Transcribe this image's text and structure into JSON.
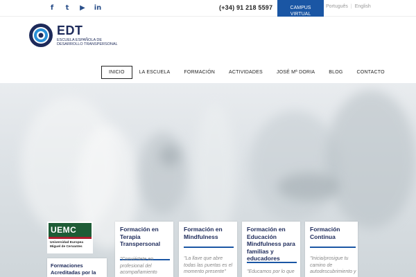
{
  "topbar": {
    "social": [
      {
        "icon": "facebook-icon",
        "glyph": "f"
      },
      {
        "icon": "twitter-icon",
        "glyph": "t"
      },
      {
        "icon": "youtube-icon",
        "glyph": "▶"
      },
      {
        "icon": "linkedin-icon",
        "glyph": "in"
      }
    ],
    "phone": "(+34) 91 218 5597",
    "campus_line1": "CAMPUS",
    "campus_line2": "VIRTUAL",
    "lang_pt": "Português",
    "lang_sep": "|",
    "lang_en": "English"
  },
  "header": {
    "logo_title": "EDT",
    "logo_sub1": "ESCUELA ESPAÑOLA DE",
    "logo_sub2": "DESARROLLO TRANSPERSONAL"
  },
  "nav": [
    {
      "label": "INICIO",
      "active": true
    },
    {
      "label": "LA ESCUELA",
      "active": false
    },
    {
      "label": "FORMACIÓN",
      "active": false
    },
    {
      "label": "ACTIVIDADES",
      "active": false
    },
    {
      "label": "JOSÉ Mª DORIA",
      "active": false
    },
    {
      "label": "BLOG",
      "active": false
    },
    {
      "label": "CONTACTO",
      "active": false
    }
  ],
  "sidebar": {
    "uemc_logo": "UEMC",
    "uemc_line1": "Universidad Europea",
    "uemc_line2": "Miguel de Cervantes",
    "acred_title": "Formaciones Acreditadas por la UEMC"
  },
  "cards": [
    {
      "title": "Formación en Terapia Transpersonal",
      "quote": "\"Conviértete en profesional del acompañamiento"
    },
    {
      "title": "Formación en Mindfulness",
      "quote": "\"La llave que abre todas las puertas es el momento presente\""
    },
    {
      "title": "Formación en Educación Mindfulness para familias y educadores",
      "quote": "\"Educamos por lo que"
    },
    {
      "title": "Formación Continua",
      "quote": "\"Inicia/prosigue tu camino de autodescubrimiento y"
    }
  ],
  "colors": {
    "brand_blue": "#1a56a4",
    "navy": "#1d2a5a",
    "uemc_green": "#1e5c36"
  }
}
